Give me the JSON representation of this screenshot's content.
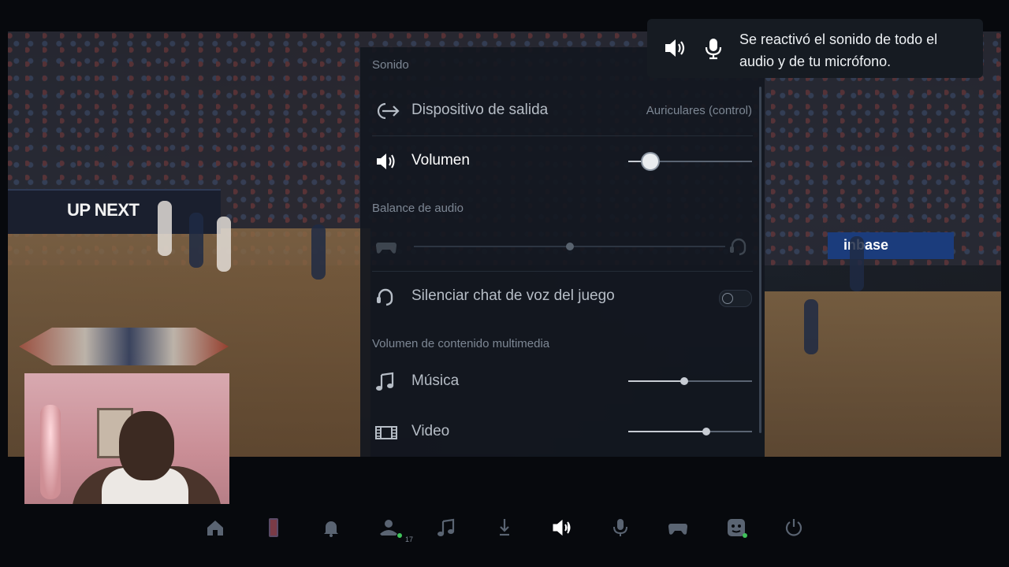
{
  "toast": {
    "message": "Se reactivó el sonido de todo el audio y de tu micrófono.",
    "icons": [
      "speaker-icon",
      "microphone-icon"
    ]
  },
  "panel": {
    "section_sound": "Sonido",
    "output_device": {
      "label": "Dispositivo de salida",
      "value": "Auriculares (control)",
      "icon": "output-arrow-icon"
    },
    "volume": {
      "label": "Volumen",
      "level": 0.18,
      "icon": "speaker-icon"
    },
    "section_balance": "Balance de audio",
    "balance": {
      "level": 0.5,
      "left_icon": "gamepad-icon",
      "right_icon": "headset-icon"
    },
    "mute_game_chat": {
      "label": "Silenciar chat de voz del juego",
      "on": false,
      "icon": "headset-icon"
    },
    "section_media": "Volumen de contenido multimedia",
    "music": {
      "label": "Música",
      "level": 0.45,
      "icon": "music-note-icon"
    },
    "video": {
      "label": "Video",
      "level": 0.63,
      "icon": "film-icon"
    }
  },
  "background": {
    "ad_text": "UP NEXT",
    "brand_text": "inbase"
  },
  "bottom_bar": {
    "items": [
      "home-icon",
      "nba-icon",
      "notifications-icon",
      "game-base-icon",
      "music-icon",
      "downloads-icon",
      "sound-icon",
      "mic-icon",
      "accessories-icon",
      "account-icon",
      "power-icon"
    ],
    "active": "sound-icon",
    "game_base_count": "17"
  },
  "colors": {
    "panel_bg": "#12171f",
    "toast_bg": "#161b22",
    "accent_green": "#3fc25a"
  }
}
